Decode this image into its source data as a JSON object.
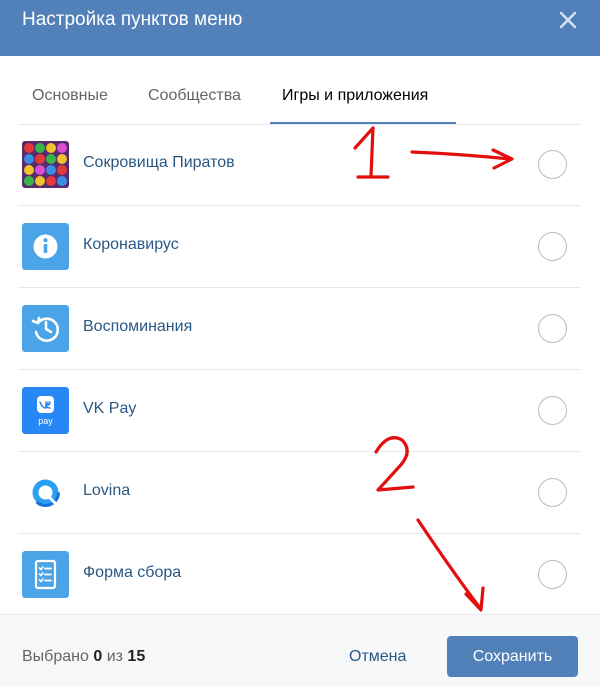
{
  "window": {
    "title": "Настройка пунктов меню"
  },
  "tabs": [
    {
      "label": "Основные",
      "active": false
    },
    {
      "label": "Сообщества",
      "active": false
    },
    {
      "label": "Игры и приложения",
      "active": true
    }
  ],
  "apps": [
    {
      "name": "Сокровища Пиратов",
      "icon": "pirate-treasure-game-icon",
      "selected": false
    },
    {
      "name": "Коронавирус",
      "icon": "info-icon",
      "selected": false
    },
    {
      "name": "Воспоминания",
      "icon": "history-icon",
      "selected": false
    },
    {
      "name": "VK Pay",
      "icon": "vk-pay-icon",
      "selected": false
    },
    {
      "name": "Lovina",
      "icon": "lovina-logo-icon",
      "selected": false
    },
    {
      "name": "Форма сбора",
      "icon": "form-icon",
      "selected": false
    }
  ],
  "footer": {
    "counter_prefix": "Выбрано",
    "counter_selected": "0",
    "counter_mid": "из",
    "counter_total": "15",
    "cancel_label": "Отмена",
    "save_label": "Сохранить"
  },
  "annotations": [
    {
      "label": "1",
      "color": "#e30e0e"
    },
    {
      "label": "2",
      "color": "#e30e0e"
    }
  ],
  "colors": {
    "header": "#5181b8",
    "link": "#2a5885",
    "button": "#5181b8",
    "annotation": "#e30e0e"
  }
}
